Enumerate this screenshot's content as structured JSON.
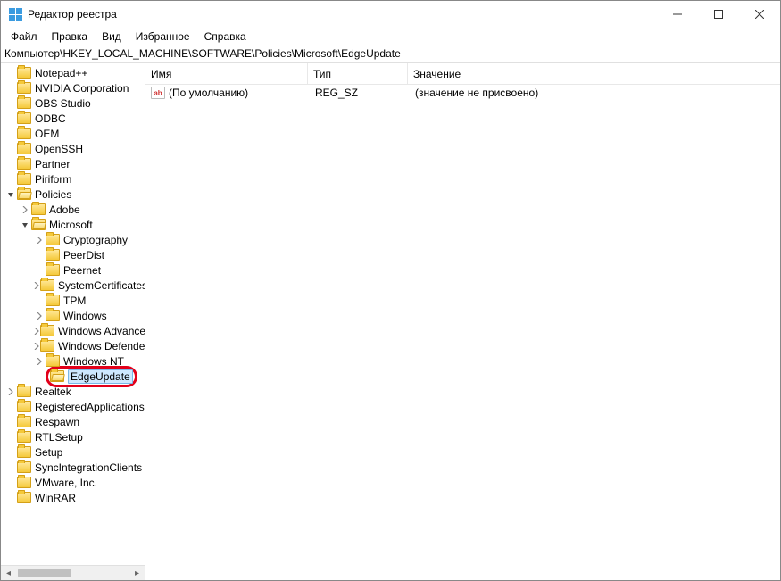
{
  "window": {
    "title": "Редактор реестра"
  },
  "menu": {
    "file": "Файл",
    "edit": "Правка",
    "view": "Вид",
    "favorites": "Избранное",
    "help": "Справка"
  },
  "address": "Компьютер\\HKEY_LOCAL_MACHINE\\SOFTWARE\\Policies\\Microsoft\\EdgeUpdate",
  "columns": {
    "name": "Имя",
    "type": "Тип",
    "value": "Значение"
  },
  "values": [
    {
      "name": "(По умолчанию)",
      "type": "REG_SZ",
      "value": "(значение не присвоено)"
    }
  ],
  "tree": [
    {
      "indent": 0,
      "chevron": "",
      "open": false,
      "label": "Notepad++"
    },
    {
      "indent": 0,
      "chevron": "",
      "open": false,
      "label": "NVIDIA Corporation"
    },
    {
      "indent": 0,
      "chevron": "",
      "open": false,
      "label": "OBS Studio"
    },
    {
      "indent": 0,
      "chevron": "",
      "open": false,
      "label": "ODBC"
    },
    {
      "indent": 0,
      "chevron": "",
      "open": false,
      "label": "OEM"
    },
    {
      "indent": 0,
      "chevron": "",
      "open": false,
      "label": "OpenSSH"
    },
    {
      "indent": 0,
      "chevron": "",
      "open": false,
      "label": "Partner"
    },
    {
      "indent": 0,
      "chevron": "",
      "open": false,
      "label": "Piriform"
    },
    {
      "indent": 0,
      "chevron": "down",
      "open": true,
      "label": "Policies"
    },
    {
      "indent": 1,
      "chevron": "right",
      "open": false,
      "label": "Adobe"
    },
    {
      "indent": 1,
      "chevron": "down",
      "open": true,
      "label": "Microsoft"
    },
    {
      "indent": 2,
      "chevron": "right",
      "open": false,
      "label": "Cryptography"
    },
    {
      "indent": 2,
      "chevron": "",
      "open": false,
      "label": "PeerDist"
    },
    {
      "indent": 2,
      "chevron": "",
      "open": false,
      "label": "Peernet"
    },
    {
      "indent": 2,
      "chevron": "right",
      "open": false,
      "label": "SystemCertificates"
    },
    {
      "indent": 2,
      "chevron": "",
      "open": false,
      "label": "TPM"
    },
    {
      "indent": 2,
      "chevron": "right",
      "open": false,
      "label": "Windows"
    },
    {
      "indent": 2,
      "chevron": "right",
      "open": false,
      "label": "Windows Advanced Threat Protection"
    },
    {
      "indent": 2,
      "chevron": "right",
      "open": false,
      "label": "Windows Defender"
    },
    {
      "indent": 2,
      "chevron": "right",
      "open": false,
      "label": "Windows NT",
      "strike": true
    },
    {
      "indent": 2,
      "chevron": "",
      "open": true,
      "label": "EdgeUpdate",
      "selected": true,
      "highlight": true
    },
    {
      "indent": 0,
      "chevron": "right",
      "open": false,
      "label": "Realtek",
      "strike": true
    },
    {
      "indent": 0,
      "chevron": "",
      "open": false,
      "label": "RegisteredApplications"
    },
    {
      "indent": 0,
      "chevron": "",
      "open": false,
      "label": "Respawn"
    },
    {
      "indent": 0,
      "chevron": "",
      "open": false,
      "label": "RTLSetup"
    },
    {
      "indent": 0,
      "chevron": "",
      "open": false,
      "label": "Setup"
    },
    {
      "indent": 0,
      "chevron": "",
      "open": false,
      "label": "SyncIntegrationClients"
    },
    {
      "indent": 0,
      "chevron": "",
      "open": false,
      "label": "VMware, Inc."
    },
    {
      "indent": 0,
      "chevron": "",
      "open": false,
      "label": "WinRAR"
    }
  ]
}
